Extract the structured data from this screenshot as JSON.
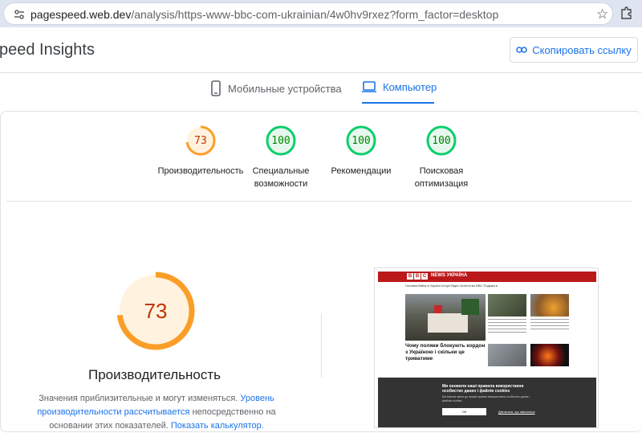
{
  "browser": {
    "url_host": "pagespeed.web.dev",
    "url_path": "/analysis/https-www-bbc-com-ukrainian/4w0hv9rxez?form_factor=desktop"
  },
  "header": {
    "brand": "peed Insights",
    "copy_button": "Скопировать ссылку"
  },
  "tabs": [
    {
      "label": "Мобильные устройства",
      "selected": false
    },
    {
      "label": "Компьютер",
      "selected": true
    }
  ],
  "scores": [
    {
      "value": "73",
      "label_line1": "Производительность",
      "label_line2": "",
      "color": "#fa9e28"
    },
    {
      "value": "100",
      "label_line1": "Специальные",
      "label_line2": "возможности",
      "color": "#0cce6b"
    },
    {
      "value": "100",
      "label_line1": "Рекомендации",
      "label_line2": "",
      "color": "#0cce6b"
    },
    {
      "value": "100",
      "label_line1": "Поисковая",
      "label_line2": "оптимизация",
      "color": "#0cce6b"
    }
  ],
  "performance": {
    "score": "73",
    "score_fraction": 0.73,
    "title": "Производительность",
    "desc_prefix": "Значения приблизительные и могут изменяться.",
    "desc_link1": "Уровень производительности рассчитывается",
    "desc_middle": "непосредственно на основании",
    "desc_tail": "этих показателей.",
    "desc_link2": "Показать калькулятор."
  },
  "thumbnail": {
    "logo_letters": [
      "B",
      "B",
      "C"
    ],
    "news_label": "NEWS УКРАЇНА",
    "nav": "Головна   Війна в Україні   Історії   Відео   Агентство BBC   Подкасти",
    "headline": "Чому поляки блокують кордон з Україною і скільки це триватиме",
    "cookie_title": "Ми оновили наші правила використання особистих даних і файлів cookies",
    "cookie_text": "Ми внесли зміни до наших правил використання особистих даних і файлів cookies.",
    "cookie_ok": "OK",
    "cookie_link": "Дізнатися, що змінилося"
  },
  "colors": {
    "accent": "#1a73e8",
    "average": "#fa9e28",
    "pass": "#0cce6b",
    "bbc_red": "#bb1919"
  }
}
